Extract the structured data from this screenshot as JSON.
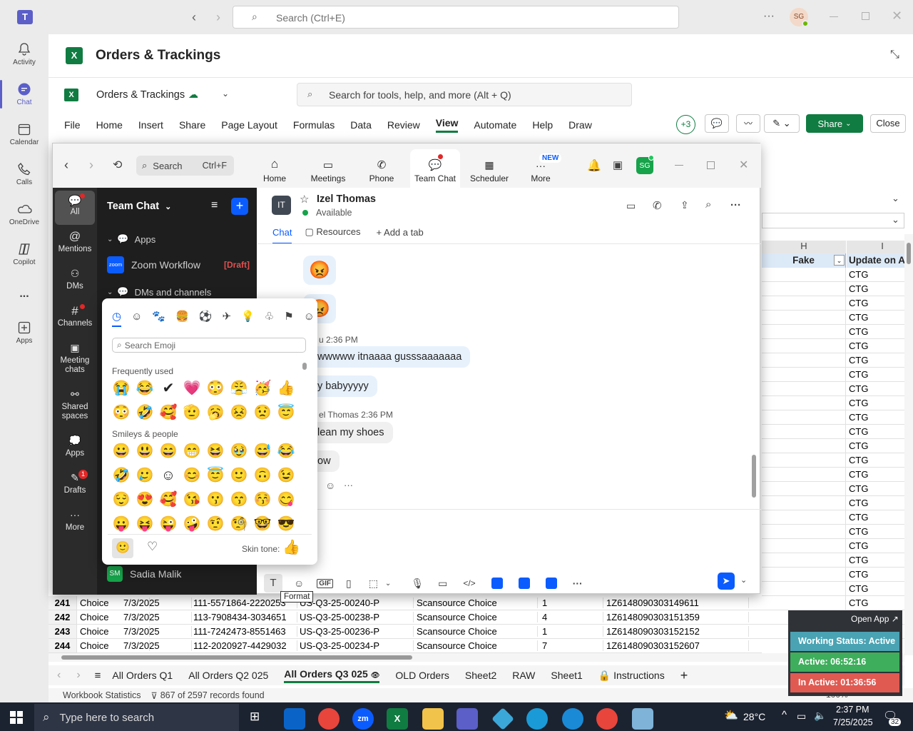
{
  "teams": {
    "search_placeholder": "Search (Ctrl+E)",
    "avatar_initials": "SG",
    "rail": [
      {
        "label": "Activity"
      },
      {
        "label": "Chat"
      },
      {
        "label": "Calendar"
      },
      {
        "label": "Calls"
      },
      {
        "label": "OneDrive"
      },
      {
        "label": "Copilot"
      },
      {
        "label": "..."
      },
      {
        "label": "Apps"
      }
    ]
  },
  "excel": {
    "window_title": "Orders & Trackings",
    "file_name": "Orders & Trackings",
    "search_placeholder": "Search for tools, help, and more (Alt + Q)",
    "menu": [
      "File",
      "Home",
      "Insert",
      "Share",
      "Page Layout",
      "Formulas",
      "Data",
      "Review",
      "View",
      "Automate",
      "Help",
      "Draw"
    ],
    "active_menu": "View",
    "presence_count": "+3",
    "share_label": "Share",
    "close_label": "Close",
    "columns": {
      "h": "H",
      "i": "I"
    },
    "headers": {
      "fake": "Fake",
      "update": "Update on Ar"
    },
    "ctg_value": "CTG",
    "rows": [
      {
        "num": "241",
        "b": "Choice",
        "c": "7/3/2025",
        "d": "111-5571864-2220253",
        "e": "US-Q3-25-00240-P",
        "f": "Scansource Choice",
        "g": "1",
        "h": "1Z6148090303149611"
      },
      {
        "num": "242",
        "b": "Choice",
        "c": "7/3/2025",
        "d": "113-7908434-3034651",
        "e": "US-Q3-25-00238-P",
        "f": "Scansource Choice",
        "g": "4",
        "h": "1Z6148090303151359"
      },
      {
        "num": "243",
        "b": "Choice",
        "c": "7/3/2025",
        "d": "111-7242473-8551463",
        "e": "US-Q3-25-00236-P",
        "f": "Scansource Choice",
        "g": "1",
        "h": "1Z6148090303152152"
      },
      {
        "num": "244",
        "b": "Choice",
        "c": "7/3/2025",
        "d": "112-2020927-4429032",
        "e": "US-Q3-25-00234-P",
        "f": "Scansource Choice",
        "g": "7",
        "h": "1Z6148090303152607"
      }
    ],
    "sheets": [
      "All Orders Q1",
      "All Orders Q2 025",
      "All Orders Q3 025",
      "OLD Orders",
      "Sheet2",
      "RAW",
      "Sheet1",
      "Instructions"
    ],
    "active_sheet": "All Orders Q3 025",
    "status_left": "Workbook Statistics",
    "records": "867 of 2597 records found",
    "zoom_level": "100%"
  },
  "zoom": {
    "nav_search_label": "Search",
    "nav_search_shortcut": "Ctrl+F",
    "nav_tabs": [
      "Home",
      "Meetings",
      "Phone",
      "Team Chat",
      "Scheduler",
      "More"
    ],
    "new_badge": "NEW",
    "avatar_initials": "SG",
    "left_items": [
      "All",
      "Mentions",
      "DMs",
      "Channels",
      "Meeting chats",
      "Shared spaces",
      "Apps",
      "Drafts",
      "More"
    ],
    "drafts_badge": "1",
    "list_title": "Team Chat",
    "section_apps": "Apps",
    "workflow_name": "Zoom Workflow",
    "draft_tag": "[Draft]",
    "section_dms": "DMs and channels",
    "contact_initials": "SM",
    "contact_name": "Sadia Malik",
    "chat_initials": "IT",
    "chat_name": "Izel Thomas",
    "chat_status": "Available",
    "chat_tabs": [
      "Chat",
      "Resources",
      "Add a tab"
    ],
    "messages": [
      {
        "meta": "u 2:36 PM",
        "text": "wwwww itnaaaa gusssaaaaaaa"
      },
      {
        "text": "y babyyyyy"
      },
      {
        "meta": "el Thomas 2:36 PM",
        "text": "lean my shoes"
      },
      {
        "text": "ow"
      }
    ],
    "format_tooltip": "Format"
  },
  "emoji_picker": {
    "search_placeholder": "Search Emoji",
    "frequently_used_label": "Frequently used",
    "smileys_label": "Smileys & people",
    "skin_tone_label": "Skin tone:",
    "frequently_used": [
      "😭",
      "😂",
      "✔",
      "💗",
      "😳",
      "😤",
      "🥳",
      "👍",
      "😳",
      "🤣",
      "🥰",
      "🫡",
      "🥱",
      "😣",
      "😟",
      "😇"
    ],
    "smileys": [
      "😀",
      "😃",
      "😄",
      "😁",
      "😆",
      "🥹",
      "😅",
      "😂",
      "🤣",
      "🥲",
      "☺",
      "😊",
      "😇",
      "🙂",
      "🙃",
      "😉",
      "😌",
      "😍",
      "🥰",
      "😘",
      "😗",
      "😙",
      "😚",
      "😋",
      "😛",
      "😝",
      "😜",
      "🤪",
      "🤨",
      "🧐",
      "🤓",
      "😎"
    ]
  },
  "status_widget": {
    "open_app": "Open App ↗",
    "working": "Working Status: Active",
    "active": "Active: 06:52:16",
    "inactive": "In Active: 01:36:56"
  },
  "taskbar": {
    "search_placeholder": "Type here to search",
    "weather": "28°C",
    "time": "2:37 PM",
    "date": "7/25/2025",
    "notifications": "32"
  }
}
